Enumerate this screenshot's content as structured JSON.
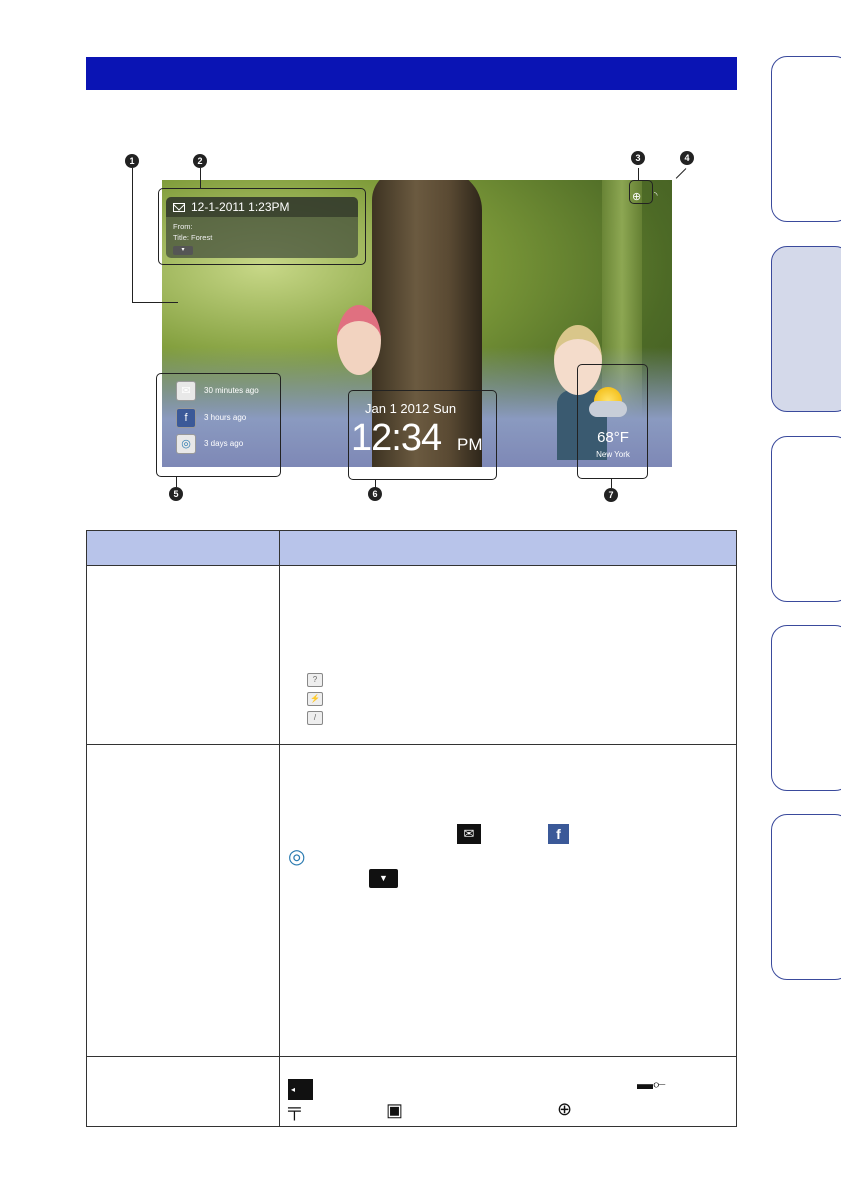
{
  "callouts": [
    "1",
    "2",
    "3",
    "4",
    "5",
    "6",
    "7"
  ],
  "message": {
    "datetime": "12-1-2011   1:23PM",
    "from": "From:",
    "title": "Title: Forest",
    "expand_glyph": "▾"
  },
  "notifications": [
    {
      "icon": "mail-icon",
      "glyph": "✉",
      "label": "30 minutes ago"
    },
    {
      "icon": "facebook-icon",
      "glyph": "f",
      "label": "3 hours ago"
    },
    {
      "icon": "photo-sharing-icon",
      "glyph": "◎",
      "label": "3 days ago"
    }
  ],
  "clock": {
    "date": "Jan 1 2012 Sun",
    "time": "12:34",
    "ampm": "PM"
  },
  "weather": {
    "temp": "68°F",
    "city": "New York"
  },
  "status_icons": [
    "network-icon",
    "wifi-icon"
  ],
  "table_icons": {
    "row1": [
      "unknown-file-icon",
      "broken-file-icon",
      "unsupported-file-icon"
    ],
    "row2": [
      "mail-icon",
      "facebook-icon",
      "photo-sharing-icon",
      "expand-button-icon"
    ],
    "row3": [
      "memory-card-icon",
      "usb-icon",
      "internal-memory-icon",
      "network-icon",
      "usb-network-icon"
    ]
  },
  "colors": {
    "header": "#0a14b4",
    "table_header": "#b8c4ea",
    "tab_border": "#3a4a9c",
    "tab_active": "#d4d9ea"
  }
}
